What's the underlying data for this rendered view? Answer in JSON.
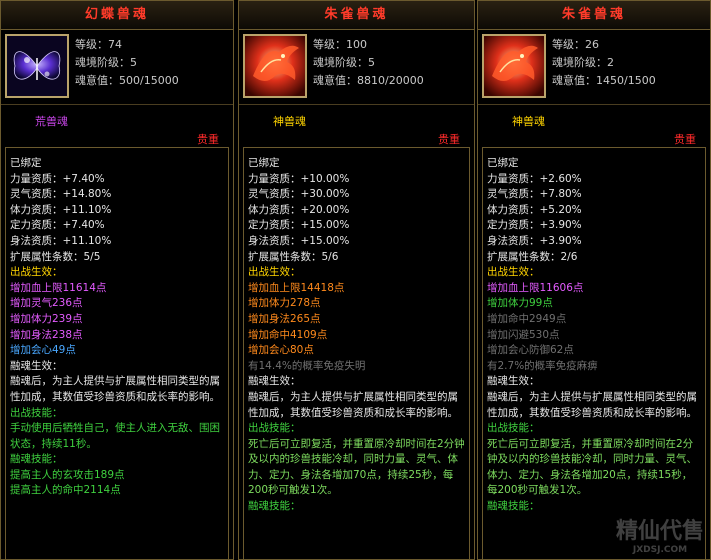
{
  "panels": [
    {
      "title": "幻蝶兽魂",
      "stats": {
        "level": "等级：74",
        "tier": "魂境阶级：5",
        "soul": "魂意值：500/15000"
      },
      "type": "荒兽魂",
      "type_color": "#c845e8",
      "rarity": "贵重",
      "bound": "已绑定",
      "attrs": [
        "力量资质：+7.40%",
        "灵气资质：+14.80%",
        "体力资质：+11.10%",
        "定力资质：+7.40%",
        "身法资质：+11.10%"
      ],
      "ext_count": "扩展属性条数：5/5",
      "battle_title": "出战生效：",
      "battle": [
        {
          "text": "增加血上限11614点",
          "color": "magenta"
        },
        {
          "text": "增加灵气236点",
          "color": "magenta"
        },
        {
          "text": "增加体力239点",
          "color": "magenta"
        },
        {
          "text": "增加身法238点",
          "color": "magenta"
        },
        {
          "text": "增加会心49点",
          "color": "blue"
        }
      ],
      "fuse_title": "融魂生效：",
      "fuse_desc": "融魂后，为主人提供与扩展属性相同类型的属性加成，其数值受珍兽资质和成长率的影响。",
      "skill_title": "出战技能：",
      "skill_desc": "手动使用后牺牲自己，使主人进入无敌、围困状态，持续11秒。",
      "fskill_title": "融魂技能：",
      "fskills": [
        "提高主人的玄攻击189点",
        "提高主人的命中2114点"
      ]
    },
    {
      "title": "朱雀兽魂",
      "stats": {
        "level": "等级：100",
        "tier": "魂境阶级：5",
        "soul": "魂意值：8810/20000"
      },
      "type": "神兽魂",
      "type_color": "#ffd400",
      "rarity": "贵重",
      "bound": "已绑定",
      "attrs": [
        "力量资质：+10.00%",
        "灵气资质：+30.00%",
        "体力资质：+20.00%",
        "定力资质：+15.00%",
        "身法资质：+15.00%"
      ],
      "ext_count": "扩展属性条数：5/6",
      "battle_title": "出战生效：",
      "battle": [
        {
          "text": "增加血上限14418点",
          "color": "orange"
        },
        {
          "text": "增加体力278点",
          "color": "orange"
        },
        {
          "text": "增加身法265点",
          "color": "orange"
        },
        {
          "text": "增加命中4109点",
          "color": "orange"
        },
        {
          "text": "增加会心80点",
          "color": "orange"
        },
        {
          "text": "有14.4%的概率免疫失明",
          "color": "gray"
        }
      ],
      "fuse_title": "融魂生效：",
      "fuse_desc": "融魂后，为主人提供与扩展属性相同类型的属性加成，其数值受珍兽资质和成长率的影响。",
      "skill_title": "出战技能：",
      "skill_desc": "死亡后可立即复活，并重置原冷却时间在2分钟及以内的珍兽技能冷却，同时力量、灵气、体力、定力、身法各增加70点，持续25秒，每200秒可触发1次。",
      "fskill_title": "融魂技能：",
      "fskills": []
    },
    {
      "title": "朱雀兽魂",
      "stats": {
        "level": "等级：26",
        "tier": "魂境阶级：2",
        "soul": "魂意值：1450/1500"
      },
      "type": "神兽魂",
      "type_color": "#ffd400",
      "rarity": "贵重",
      "bound": "已绑定",
      "attrs": [
        "力量资质：+2.60%",
        "灵气资质：+7.80%",
        "体力资质：+5.20%",
        "定力资质：+3.90%",
        "身法资质：+3.90%"
      ],
      "ext_count": "扩展属性条数：2/6",
      "battle_title": "出战生效：",
      "battle": [
        {
          "text": "增加血上限11606点",
          "color": "magenta"
        },
        {
          "text": "增加体力99点",
          "color": "green"
        },
        {
          "text": "增加命中2949点",
          "color": "gray"
        },
        {
          "text": "增加闪避530点",
          "color": "gray"
        },
        {
          "text": "增加会心防御62点",
          "color": "gray"
        },
        {
          "text": "有2.7%的概率免疫麻痹",
          "color": "gray"
        }
      ],
      "fuse_title": "融魂生效：",
      "fuse_desc": "融魂后，为主人提供与扩展属性相同类型的属性加成，其数值受珍兽资质和成长率的影响。",
      "skill_title": "出战技能：",
      "skill_desc": "死亡后可立即复活，并重置原冷却时间在2分钟及以内的珍兽技能冷却，同时力量、灵气、体力、定力、身法各增加20点，持续15秒，每200秒可触发1次。",
      "fskill_title": "融魂技能：",
      "fskills": []
    }
  ],
  "watermark": "精仙代售",
  "watermark_sub": "JXDSJ.COM"
}
